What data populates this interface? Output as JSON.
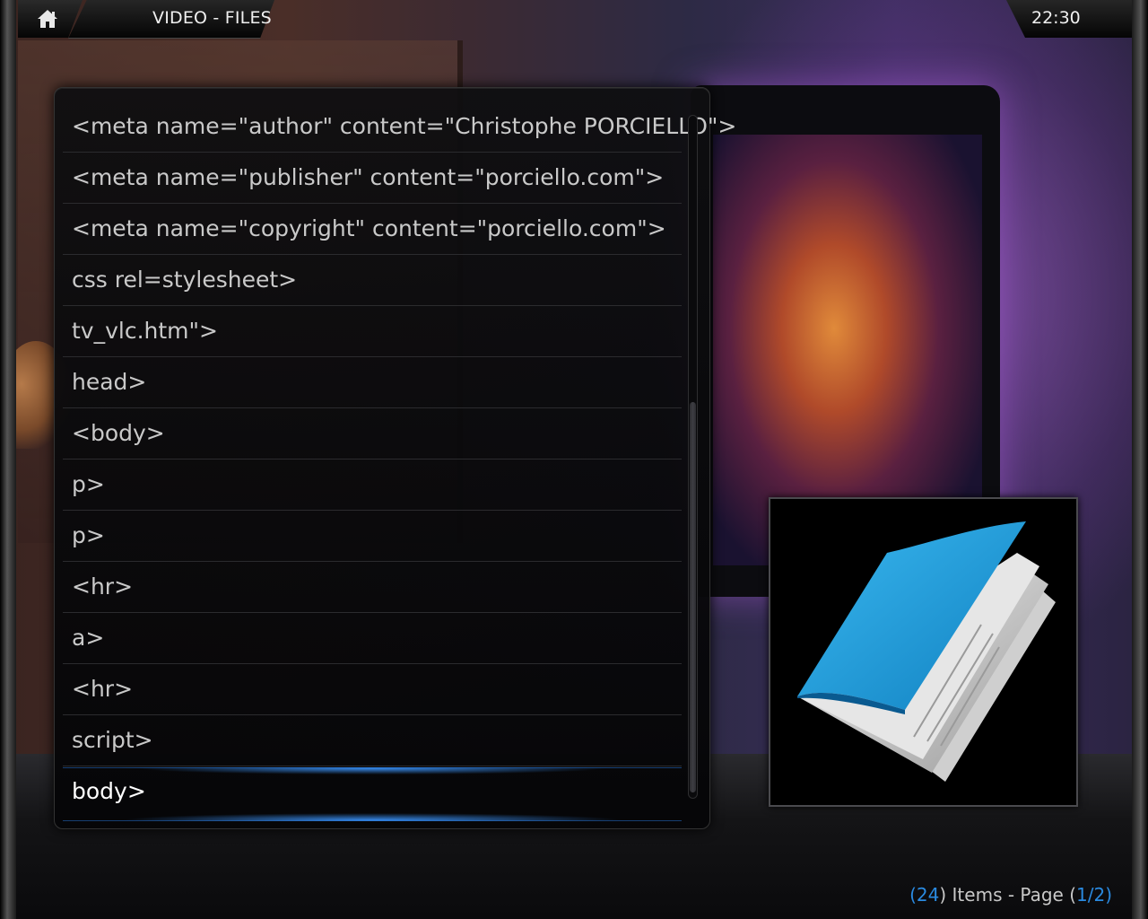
{
  "header": {
    "title": "VIDEO - FILES",
    "clock": "22:30"
  },
  "list": {
    "items": [
      "<meta name=\"author\" content=\"Christophe PORCIELLO\">",
      "<meta name=\"publisher\" content=\"porciello.com\">",
      "<meta name=\"copyright\" content=\"porciello.com\">",
      "css rel=stylesheet>",
      "tv_vlc.htm\">",
      "head>",
      "<body>",
      "p>",
      "p>",
      "<hr>",
      "a>",
      "<hr>",
      "script>",
      "body>"
    ],
    "selected_index": 13,
    "scroll_position_fraction": 0.42,
    "scroll_thumb_fraction": 0.58
  },
  "thumbnail": {
    "icon": "document-folder-icon",
    "colors": {
      "cover": "#1ea0e0",
      "pages": "#d8d8d8"
    }
  },
  "footer": {
    "open_paren": "(",
    "item_count": "24",
    "items_text": ") Items - Page (",
    "page": "1/2",
    "close_paren": ")"
  },
  "colors": {
    "accent": "#2a8ae0",
    "selection_glow": "#3c96ff",
    "text": "#c9c9c9"
  }
}
